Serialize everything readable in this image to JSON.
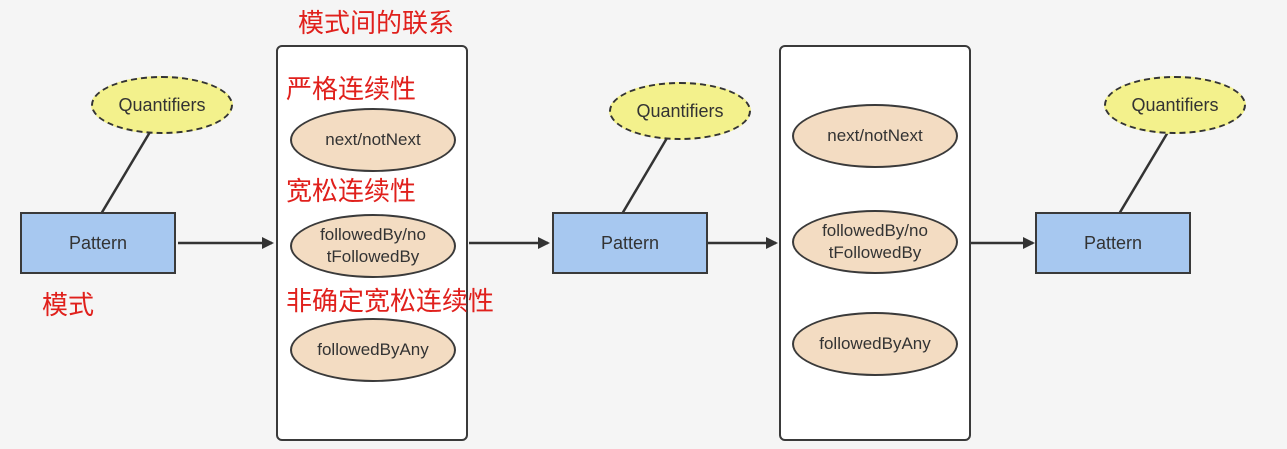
{
  "labels": {
    "title_relation": "模式间的联系",
    "strict": "严格连续性",
    "relaxed": "宽松连续性",
    "nondeterministic": "非确定宽松连续性",
    "pattern_cn": "模式"
  },
  "nodes": {
    "pattern": "Pattern",
    "quantifiers": "Quantifiers",
    "next": "next/notNext",
    "followed_line1": "followedBy/no",
    "followed_line2": "tFollowedBy",
    "followed_any": "followedByAny"
  },
  "colors": {
    "pattern_fill": "#a7c8f0",
    "quantifier_fill": "#f3f18c",
    "oval_fill": "#f3dcc2",
    "annotation": "#e0201c"
  }
}
